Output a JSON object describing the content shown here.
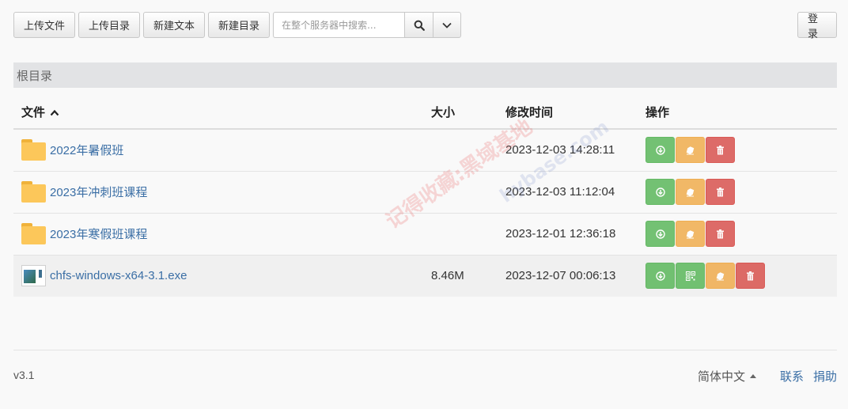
{
  "toolbar": {
    "upload_file": "上传文件",
    "upload_dir": "上传目录",
    "new_text": "新建文本",
    "new_dir": "新建目录",
    "search_placeholder": "在整个服务器中搜索...",
    "login": "登录"
  },
  "breadcrumb": "根目录",
  "table": {
    "headers": {
      "name": "文件",
      "size": "大小",
      "mtime": "修改时间",
      "actions": "操作"
    },
    "rows": [
      {
        "name": "2022年暑假班",
        "size": "",
        "mtime": "2023-12-03 14:28:11",
        "type": "folder"
      },
      {
        "name": "2023年冲刺班课程",
        "size": "",
        "mtime": "2023-12-03 11:12:04",
        "type": "folder"
      },
      {
        "name": "2023年寒假班课程",
        "size": "",
        "mtime": "2023-12-01 12:36:18",
        "type": "folder"
      },
      {
        "name": "chfs-windows-x64-3.1.exe",
        "size": "8.46M",
        "mtime": "2023-12-07 00:06:13",
        "type": "file"
      }
    ]
  },
  "footer": {
    "version": "v3.1",
    "language": "简体中文",
    "contact": "联系",
    "donate": "捐助"
  },
  "watermark": {
    "text": "记得收藏:黑域基地",
    "url": "hybase.com"
  },
  "colors": {
    "link": "#3a6ea5",
    "download_green": "#5cb85c",
    "rename_orange": "#f0ad4e",
    "delete_red": "#d9534f"
  }
}
